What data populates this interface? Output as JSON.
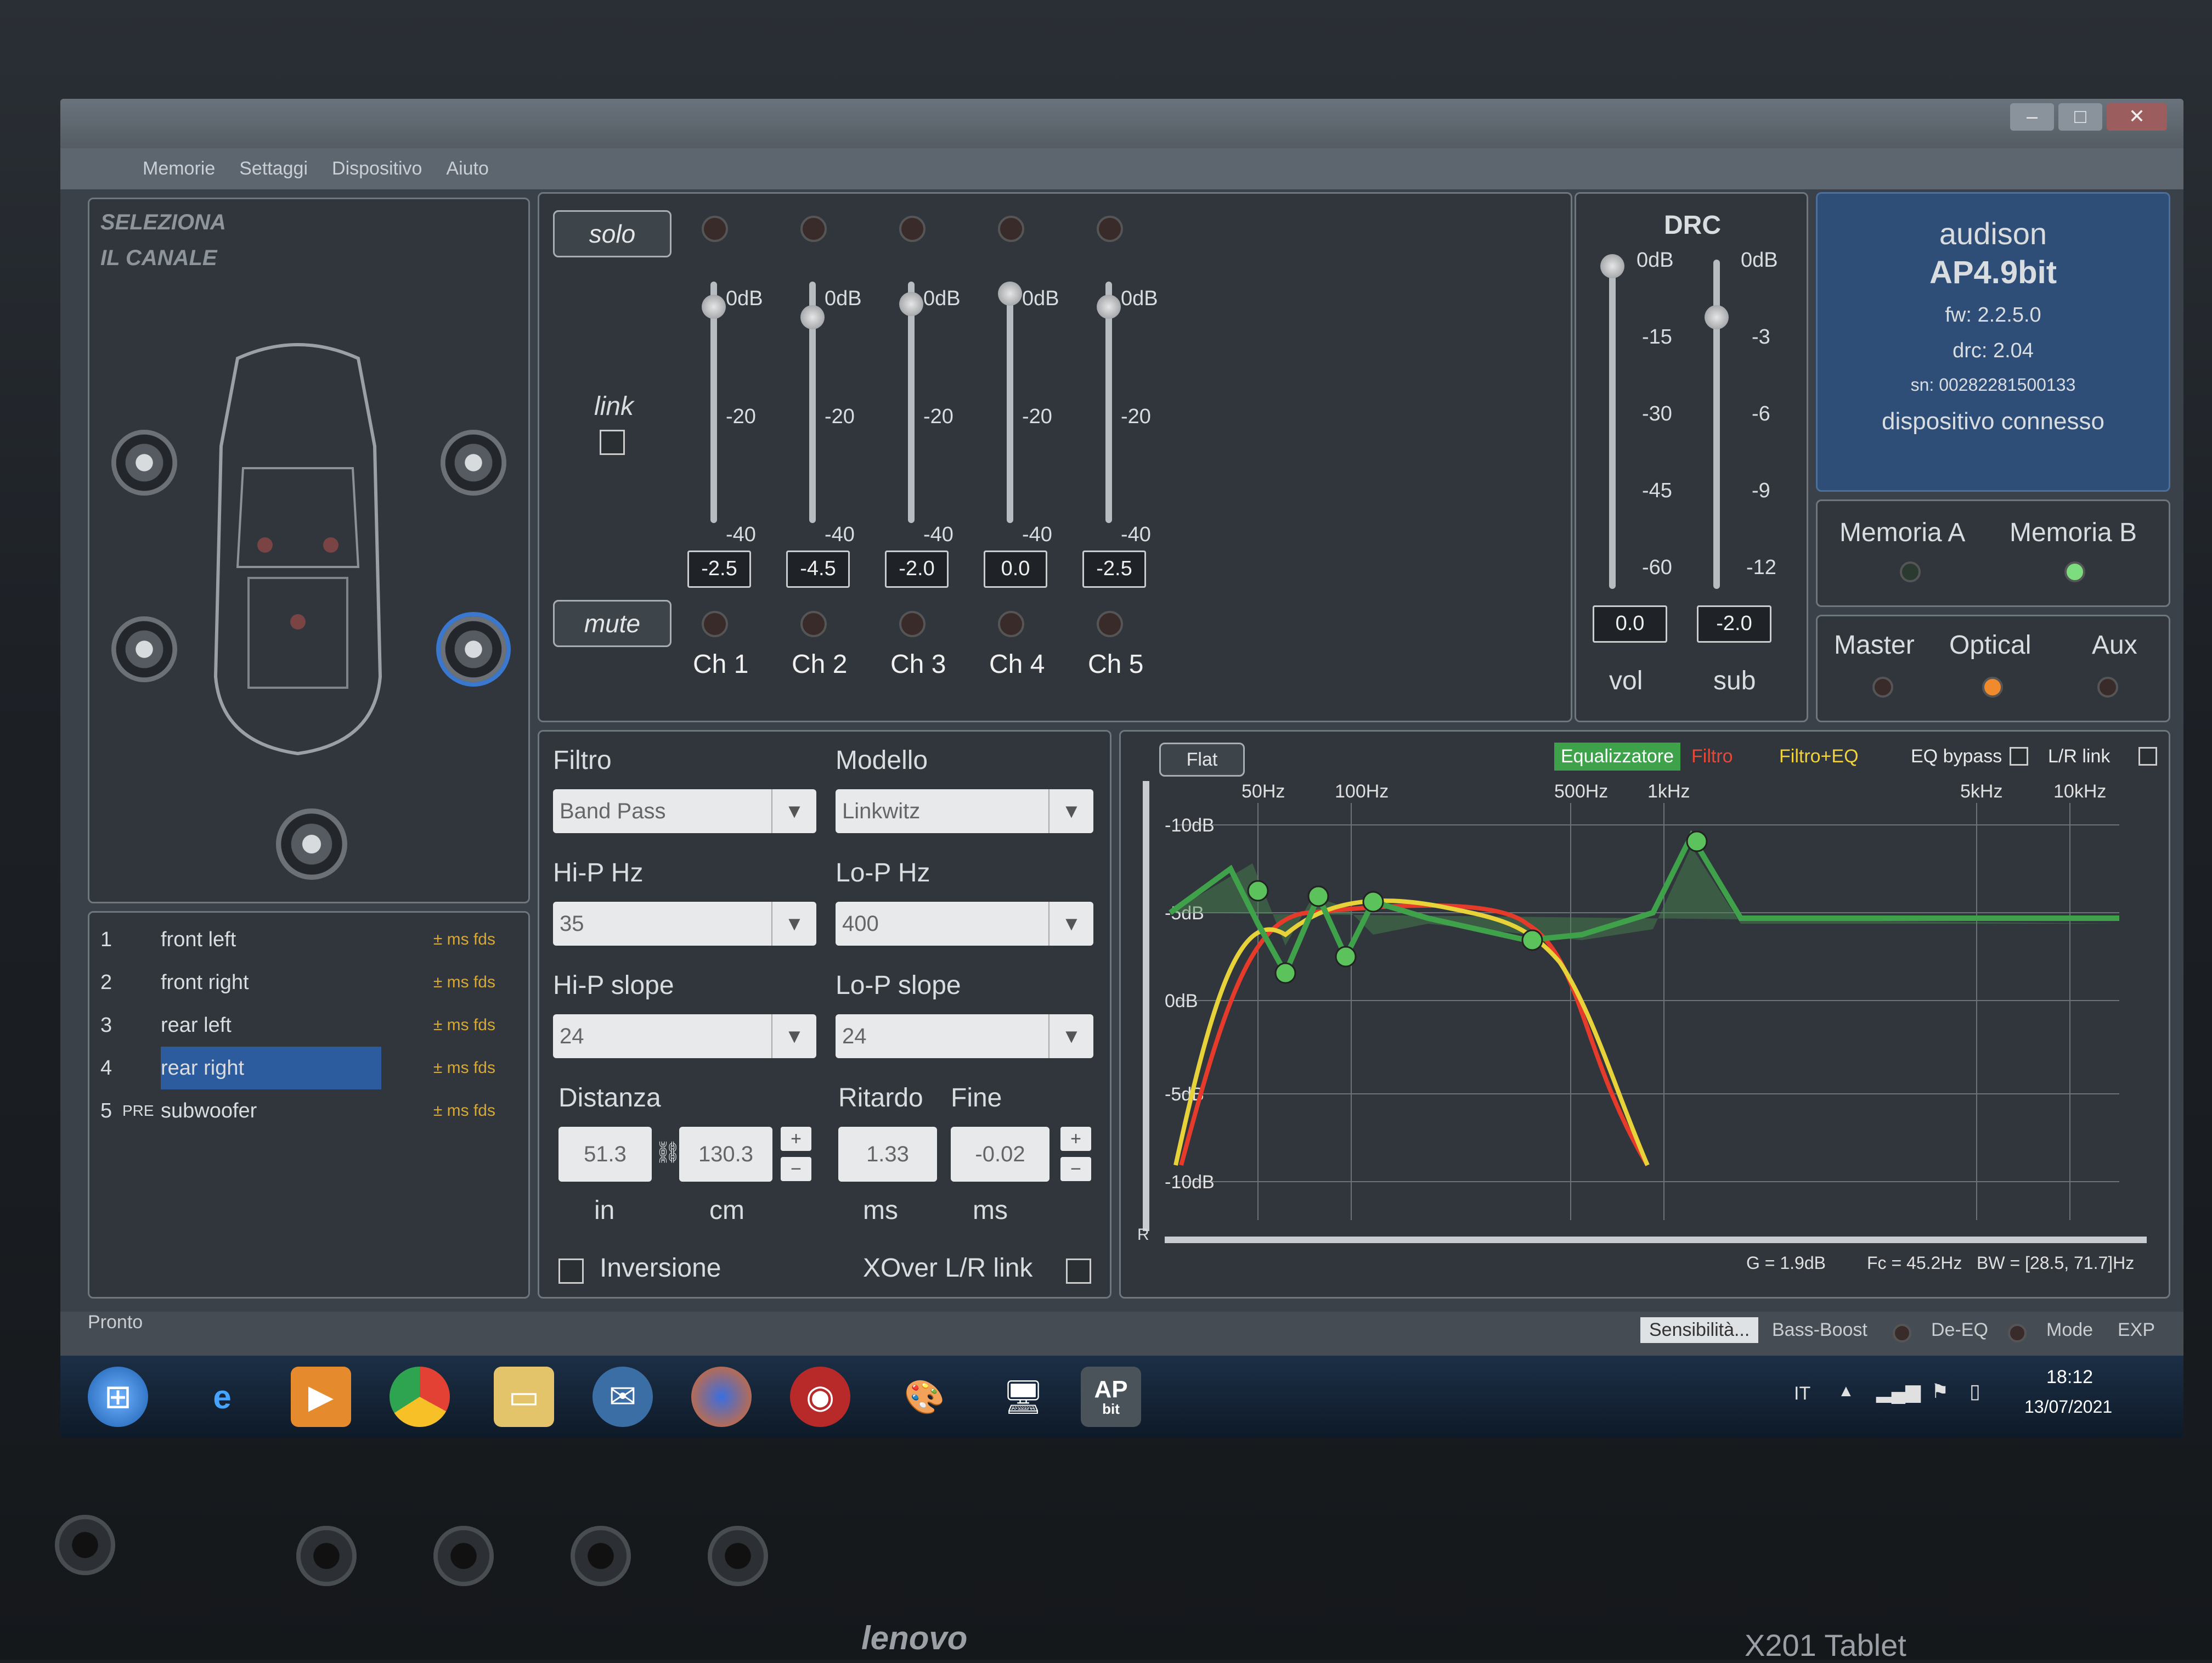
{
  "menu": [
    "Memorie",
    "Settaggi",
    "Dispositivo",
    "Aiuto"
  ],
  "left": {
    "title": [
      "SELEZIONA",
      "IL CANALE"
    ]
  },
  "channels_list": [
    {
      "n": "1",
      "pre": "",
      "name": "front left",
      "flag": "± ms fds"
    },
    {
      "n": "2",
      "pre": "",
      "name": "front right",
      "flag": "± ms fds"
    },
    {
      "n": "3",
      "pre": "",
      "name": "rear left",
      "flag": "± ms fds"
    },
    {
      "n": "4",
      "pre": "",
      "name": "rear right",
      "flag": "± ms fds"
    },
    {
      "n": "5",
      "pre": "PRE",
      "name": "subwoofer",
      "flag": "± ms fds"
    }
  ],
  "mixer": {
    "solo": "solo",
    "mute": "mute",
    "link": "link",
    "scale": [
      "0dB",
      "-20",
      "-40"
    ],
    "values": [
      "-2.5",
      "-4.5",
      "-2.0",
      "0.0",
      "-2.5"
    ],
    "levels": [
      -2.5,
      -4.5,
      -2.0,
      0.0,
      -2.5
    ],
    "channels": [
      "Ch 1",
      "Ch 2",
      "Ch 3",
      "Ch 4",
      "Ch 5"
    ]
  },
  "drc": {
    "title": "DRC",
    "vol_scale": [
      "0dB",
      "-15",
      "-30",
      "-45",
      "-60"
    ],
    "sub_scale": [
      "0dB",
      "-3",
      "-6",
      "-9",
      "-12"
    ],
    "vol": "0.0",
    "sub": "-2.0",
    "vol_label": "vol",
    "sub_label": "sub",
    "vol_level": 0.0,
    "sub_level": -2.0
  },
  "device": {
    "brand": "audison",
    "model": "AP4.9bit",
    "fw": "fw: 2.2.5.0",
    "drc": "drc: 2.04",
    "sn": "sn: 00282281500133",
    "status": "dispositivo connesso"
  },
  "memory": {
    "a": "Memoria A",
    "b": "Memoria B"
  },
  "sources": {
    "master": "Master",
    "optical": "Optical",
    "aux": "Aux"
  },
  "filter": {
    "filtro_label": "Filtro",
    "filtro": "Band Pass",
    "modello_label": "Modello",
    "modello": "Linkwitz",
    "hip_label": "Hi-P Hz",
    "hip": "35",
    "lop_label": "Lo-P Hz",
    "lop": "400",
    "hips_label": "Hi-P slope",
    "hips": "24",
    "lops_label": "Lo-P slope",
    "lops": "24",
    "distanza_label": "Distanza",
    "dist_in": "51.3",
    "dist_cm": "130.3",
    "unit_in": "in",
    "unit_cm": "cm",
    "ritardo_label": "Ritardo",
    "fine_label": "Fine",
    "ritardo": "1.33",
    "fine": "-0.02",
    "unit_ms": "ms",
    "inversione": "Inversione",
    "xover": "XOver L/R link"
  },
  "eq": {
    "flat": "Flat",
    "equalizzatore": "Equalizzatore",
    "filtro": "Filtro",
    "filtro_eq": "Filtro+EQ",
    "eq_bypass": "EQ bypass",
    "lr_link": "L/R link",
    "freq_labels": [
      "50Hz",
      "100Hz",
      "500Hz",
      "1kHz",
      "5kHz",
      "10kHz"
    ],
    "db_labels": [
      "-10dB",
      "-5dB",
      "0dB",
      "-5dB",
      "-10dB"
    ],
    "r": "R",
    "readout": {
      "g": "G = 1.9dB",
      "fc": "Fc = 45.2Hz",
      "bw": "BW = [28.5, 71.7]Hz"
    }
  },
  "statusbar": {
    "pronto": "Pronto",
    "sens": "Sensibilità...",
    "bass": "Bass-Boost",
    "deeq": "De-EQ",
    "mode": "Mode",
    "exp": "EXP"
  },
  "taskbar": {
    "lang": "IT",
    "time": "18:12",
    "date": "13/07/2021",
    "ap": "AP",
    "bit": "bit"
  },
  "hw": {
    "brand": "lenovo",
    "model": "X201 Tablet"
  }
}
